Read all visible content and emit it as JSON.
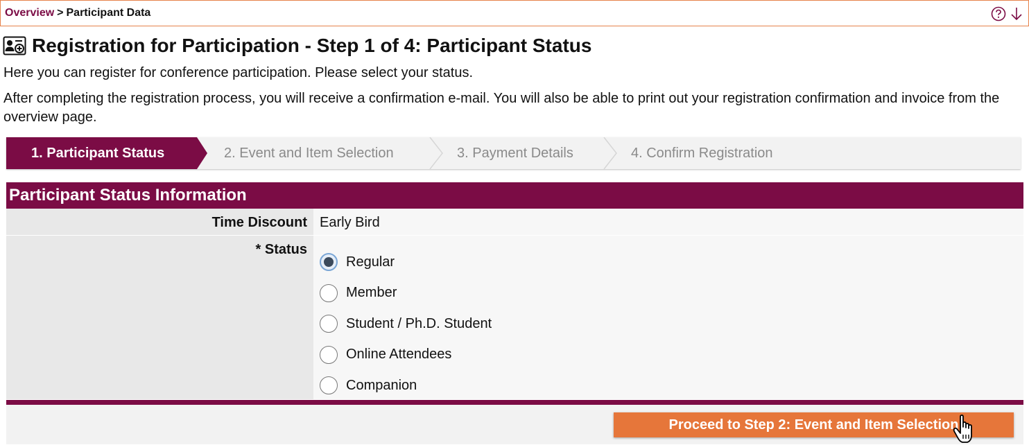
{
  "breadcrumb": {
    "link": "Overview",
    "separator": ">",
    "current": "Participant Data"
  },
  "header_icons": [
    "help-icon",
    "arrow-down-icon"
  ],
  "page": {
    "title": "Registration for Participation - Step 1 of 4: Participant Status",
    "intro": "Here you can register for conference participation. Please select your status.",
    "info": "After completing the registration process, you will receive a confirmation e-mail. You will also be able to print out your registration confirmation and invoice from the overview page."
  },
  "steps": [
    {
      "label": "1. Participant Status",
      "active": true
    },
    {
      "label": "2. Event and Item Selection",
      "active": false
    },
    {
      "label": "3. Payment Details",
      "active": false
    },
    {
      "label": "4. Confirm Registration",
      "active": false
    }
  ],
  "panel": {
    "title": "Participant Status Information",
    "time_discount_label": "Time Discount",
    "time_discount_value": "Early Bird",
    "status_label": "* Status",
    "options": [
      {
        "label": "Regular",
        "checked": true
      },
      {
        "label": "Member",
        "checked": false
      },
      {
        "label": "Student / Ph.D. Student",
        "checked": false
      },
      {
        "label": "Online Attendees",
        "checked": false
      },
      {
        "label": "Companion",
        "checked": false
      }
    ]
  },
  "proceed_button": "Proceed to Step 2: Event and Item Selection",
  "colors": {
    "brand": "#7b0c45",
    "accent": "#e6763a"
  }
}
